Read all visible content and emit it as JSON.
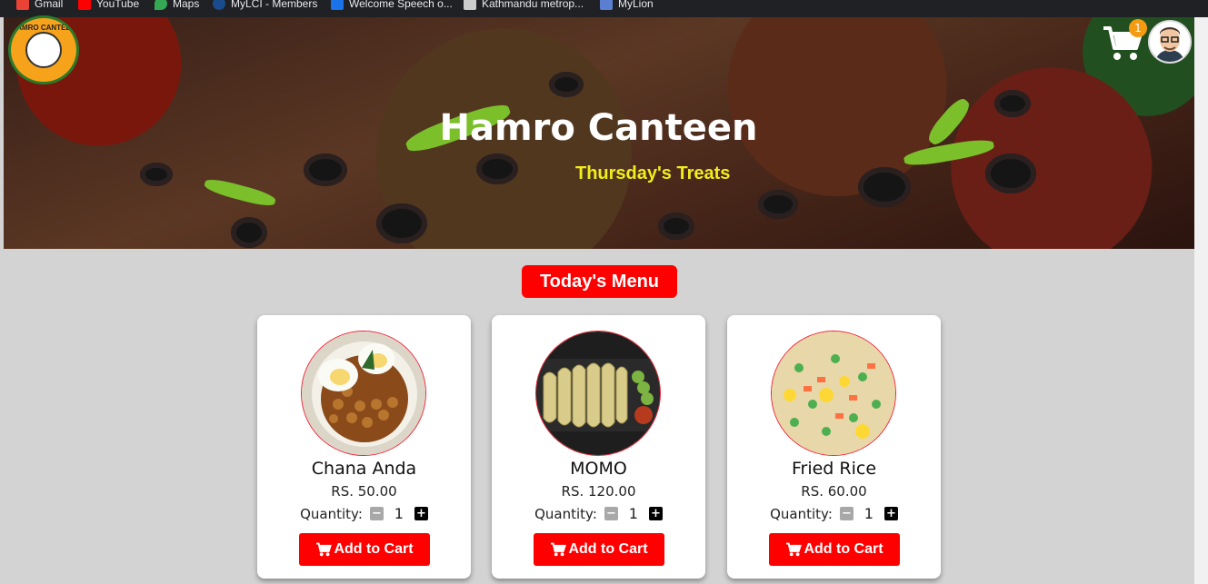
{
  "bookmarks": [
    {
      "label": "Gmail",
      "icon": "gmail-icon",
      "color": "#ea4335"
    },
    {
      "label": "YouTube",
      "icon": "youtube-icon",
      "color": "#ff0000"
    },
    {
      "label": "Maps",
      "icon": "maps-icon",
      "color": "#34a853"
    },
    {
      "label": "MyLCI - Members",
      "icon": "lions-icon",
      "color": "#1a4b8c"
    },
    {
      "label": "Welcome Speech o...",
      "icon": "doc-icon",
      "color": "#1a73e8"
    },
    {
      "label": "Kathmandu metrop...",
      "icon": "kmc-icon",
      "color": "#cccccc"
    },
    {
      "label": "MyLion",
      "icon": "mylion-icon",
      "color": "#5a7fd0"
    }
  ],
  "header": {
    "logo_text": "HAMRO CANTEEN",
    "title": "Hamro Canteen",
    "subtitle": "Thursday's Treats",
    "cart_count": "1"
  },
  "menu": {
    "title": "Today's Menu",
    "quantity_label": "Quantity:",
    "add_label": "Add to Cart",
    "items": [
      {
        "name": "Chana Anda",
        "price": "RS. 50.00",
        "qty": "1"
      },
      {
        "name": "MOMO",
        "price": "RS. 120.00",
        "qty": "1"
      },
      {
        "name": "Fried Rice",
        "price": "RS. 60.00",
        "qty": "1"
      }
    ]
  },
  "colors": {
    "accent": "#ff0000",
    "subtitle": "#f2ee1b",
    "badge": "#f39c12"
  }
}
